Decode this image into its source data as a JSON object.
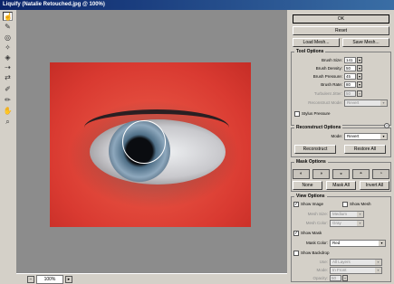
{
  "window": {
    "title": "Liquify (Natalie Retouched.jpg @ 100%)"
  },
  "tools": [
    {
      "icon": "warp-icon"
    },
    {
      "icon": "reconstruct-icon"
    },
    {
      "icon": "twirl-clockwise-icon"
    },
    {
      "icon": "pucker-icon"
    },
    {
      "icon": "bloat-icon"
    },
    {
      "icon": "shift-pixels-icon"
    },
    {
      "icon": "reflection-icon"
    },
    {
      "icon": "freeze-mask-icon"
    },
    {
      "icon": "thaw-mask-icon"
    },
    {
      "icon": "hand-icon"
    },
    {
      "icon": "zoom-icon"
    }
  ],
  "status": {
    "zoom": "100%",
    "zoom_out": "−",
    "zoom_in": "+"
  },
  "buttons": {
    "ok": "OK",
    "reset": "Reset",
    "load_mesh": "Load Mesh...",
    "save_mesh": "Save Mesh..."
  },
  "tool_options": {
    "title": "Tool Options",
    "brush_size_label": "Brush Size:",
    "brush_size": "141",
    "brush_density_label": "Brush Density:",
    "brush_density": "50",
    "brush_pressure_label": "Brush Pressure:",
    "brush_pressure": "45",
    "brush_rate_label": "Brush Rate:",
    "brush_rate": "80",
    "turbulent_jitter_label": "Turbulent Jitter:",
    "turbulent_jitter": "50",
    "reconstruct_mode_label": "Reconstruct Mode:",
    "reconstruct_mode": "Revert",
    "stylus_pressure": "Stylus Pressure"
  },
  "reconstruct_options": {
    "title": "Reconstruct Options",
    "mode_label": "Mode:",
    "mode": "Revert",
    "reconstruct": "Reconstruct",
    "restore_all": "Restore All"
  },
  "mask_options": {
    "title": "Mask Options",
    "none": "None",
    "mask_all": "Mask All",
    "invert_all": "Invert All"
  },
  "view_options": {
    "title": "View Options",
    "show_image": "Show Image",
    "show_mesh": "Show Mesh",
    "mesh_size_label": "Mesh Size:",
    "mesh_size": "Medium",
    "mesh_color_label": "Mesh Color:",
    "mesh_color": "Gray",
    "show_mask": "Show Mask",
    "mask_color_label": "Mask Color:",
    "mask_color": "Red",
    "show_backdrop": "Show Backdrop",
    "use_label": "Use:",
    "use": "All Layers",
    "mode_label": "Mode:",
    "mode": "In Front",
    "opacity_label": "Opacity:",
    "opacity": "50"
  },
  "colors": {
    "mask_overlay": "#e24a3c",
    "titlebar": "#0a246a"
  }
}
